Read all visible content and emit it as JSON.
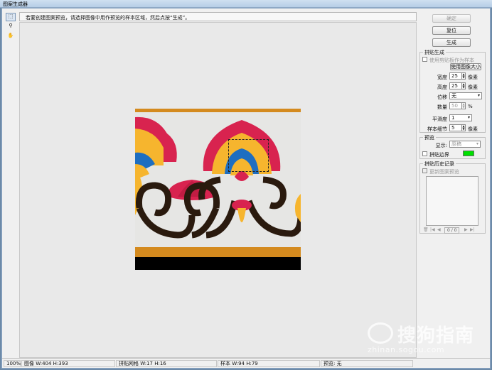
{
  "window": {
    "title": "图案生成器"
  },
  "tools": [
    {
      "name": "marquee-tool-icon",
      "glyph": "⬚"
    },
    {
      "name": "zoom-tool-icon",
      "glyph": "🔍"
    },
    {
      "name": "hand-tool-icon",
      "glyph": "✋"
    }
  ],
  "instruction": "若要创建图案预览，请选择图像中用作预览的样本区域，然后点按“生成”。",
  "buttons": {
    "ok": "确定",
    "reset": "复位",
    "generate": "生成"
  },
  "tile_generation": {
    "title": "拼贴生成",
    "use_clipboard_label": "使用剪贴板作为样本",
    "use_image_size_label": "使用图像大小",
    "width_label": "宽度",
    "width_value": "25",
    "width_unit": "像素",
    "height_label": "高度",
    "height_value": "25",
    "height_unit": "像素",
    "offset_label": "位移",
    "offset_value": "无",
    "amount_label": "数量",
    "amount_value": "50",
    "amount_unit": "%",
    "smoothness_label": "平滑度",
    "smoothness_value": "1",
    "sample_detail_label": "样本细节",
    "sample_detail_value": "5",
    "sample_detail_unit": "像素"
  },
  "preview": {
    "title": "预览",
    "show_label": "显示:",
    "show_value": "原稿",
    "tile_boundaries_label": "拼贴边界",
    "boundary_color": "#00e000"
  },
  "history": {
    "title": "拼贴历史记录",
    "update_label": "更新图案预览",
    "counter": "0 / 0"
  },
  "status": {
    "zoom": "100%",
    "image": "图像 W:404 H:393",
    "tile_grid": "拼贴网格 W:17 H:16",
    "sample": "样本 W:94 H:79",
    "preview": "预览: 无"
  },
  "watermark": {
    "line1": "搜狗指南",
    "line2": "zhinan.sogou.com"
  },
  "colors": {
    "accent_red": "#d8234f",
    "accent_orange": "#d48a1e",
    "accent_yellow": "#f6b52e",
    "accent_blue": "#1e6ec0",
    "dark_brown": "#2a1a0e"
  }
}
